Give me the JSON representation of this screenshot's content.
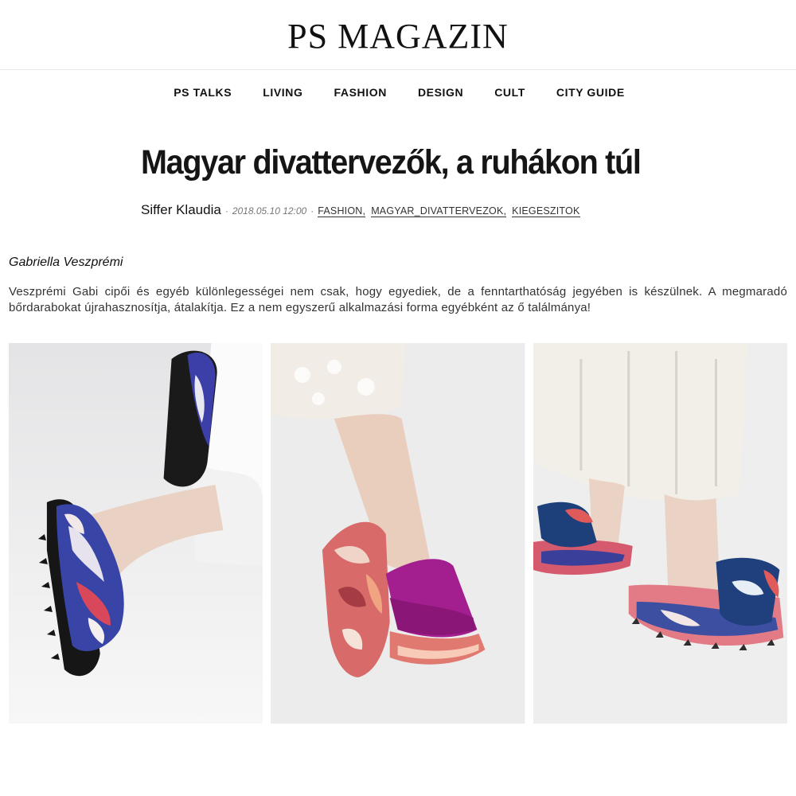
{
  "site": {
    "logo": "PS MAGAZIN"
  },
  "nav": [
    {
      "label": "PS TALKS"
    },
    {
      "label": "LIVING"
    },
    {
      "label": "FASHION"
    },
    {
      "label": "DESIGN"
    },
    {
      "label": "CULT"
    },
    {
      "label": "CITY GUIDE"
    }
  ],
  "article": {
    "title": "Magyar divattervezők, a ruhákon túl",
    "author": "Siffer Klaudia",
    "date": "2018.05.10 12:00",
    "separator": "·",
    "tags": [
      "FASHION,",
      "MAGYAR_DIVATTERVEZOK,",
      "KIEGESZITOK"
    ],
    "designer": "Gabriella Veszprémi",
    "paragraph": "Veszprémi Gabi cipői és egyéb különlegességei nem csak, hogy egyediek, de a fenntarthatóság jegyében is készülnek. A megmaradó bőrdarabokat újrahasznosítja, átalakítja. Ez a nem egyszerű alkalmazási forma egyébként az ő találmánya!"
  },
  "colors": {
    "text": "#111111",
    "muted": "#777777",
    "photo_bg": "#ededed",
    "accent_magenta": "#a31f8f",
    "accent_blue": "#2b3f9c",
    "accent_coral": "#e0707a"
  }
}
